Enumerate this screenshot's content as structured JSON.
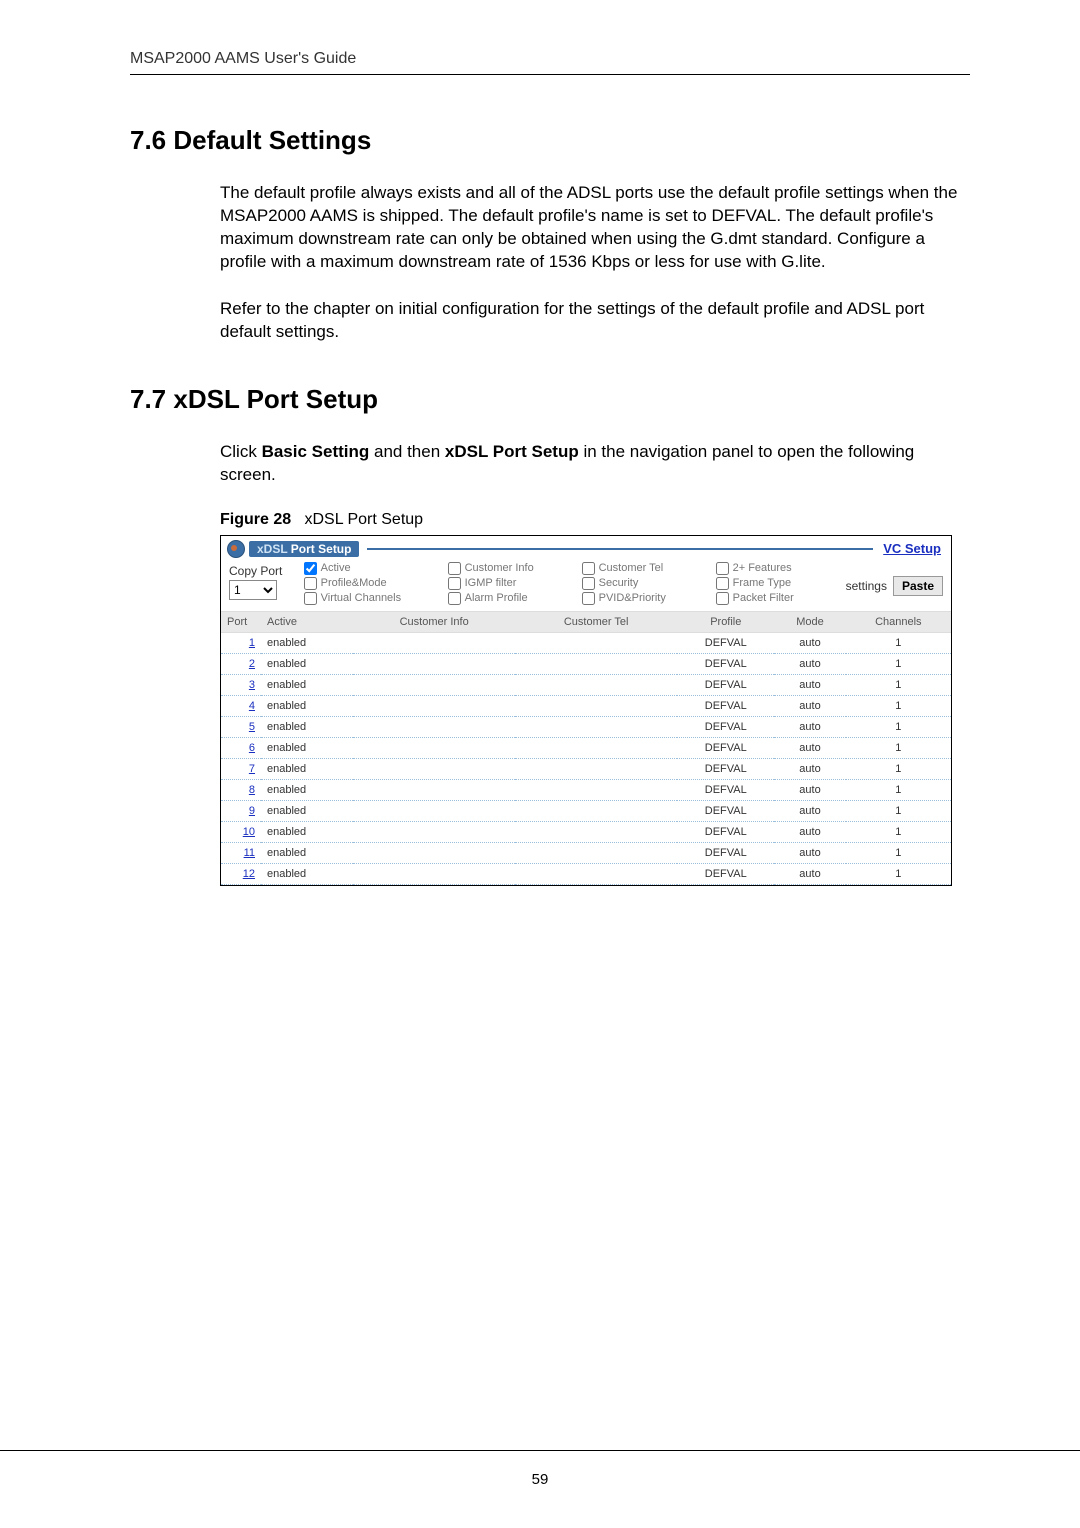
{
  "running_head": "MSAP2000 AAMS User's Guide",
  "sections": {
    "s76": {
      "heading": "7.6   Default Settings",
      "p1": "The default profile always exists and all of the ADSL ports use the default profile settings when the MSAP2000 AAMS is shipped. The default profile's name is set to DEFVAL. The default profile's maximum downstream rate can only be obtained when using the G.dmt standard. Configure a profile with a maximum downstream rate of 1536 Kbps or less for use with G.lite.",
      "p2": "Refer to the chapter on initial configuration for the settings of the default profile and ADSL port default settings."
    },
    "s77": {
      "heading": "7.7   xDSL Port Setup",
      "p1_pre": "Click ",
      "p1_b1": "Basic Setting",
      "p1_mid": " and then ",
      "p1_b2": "xDSL Port Setup",
      "p1_post": " in the navigation panel to open the following screen."
    }
  },
  "figure": {
    "label": "Figure 28",
    "caption": "xDSL Port Setup"
  },
  "screenshot": {
    "title_prefix": "xDSL",
    "title_main": " Port Setup",
    "vc_link": "VC Setup",
    "copy_label": "Copy   Port",
    "copy_options": [
      "1"
    ],
    "copy_selected": "1",
    "settings_label": "settings",
    "paste_button": "Paste",
    "checkboxes": [
      {
        "label": "Active",
        "checked": true
      },
      {
        "label": "Customer Info",
        "checked": false
      },
      {
        "label": "Customer Tel",
        "checked": false
      },
      {
        "label": "2+ Features",
        "checked": false
      },
      {
        "label": "Profile&Mode",
        "checked": false
      },
      {
        "label": "IGMP filter",
        "checked": false
      },
      {
        "label": "Security",
        "checked": false
      },
      {
        "label": "Frame Type",
        "checked": false
      },
      {
        "label": "Virtual Channels",
        "checked": false
      },
      {
        "label": "Alarm Profile",
        "checked": false
      },
      {
        "label": "PVID&Priority",
        "checked": false
      },
      {
        "label": "Packet Filter",
        "checked": false
      }
    ],
    "columns": {
      "port": "Port",
      "active": "Active",
      "custinfo": "Customer Info",
      "custtel": "Customer Tel",
      "profile": "Profile",
      "mode": "Mode",
      "channels": "Channels"
    },
    "rows": [
      {
        "port": "1",
        "active": "enabled",
        "custinfo": "",
        "custtel": "",
        "profile": "DEFVAL",
        "mode": "auto",
        "channels": "1"
      },
      {
        "port": "2",
        "active": "enabled",
        "custinfo": "",
        "custtel": "",
        "profile": "DEFVAL",
        "mode": "auto",
        "channels": "1"
      },
      {
        "port": "3",
        "active": "enabled",
        "custinfo": "",
        "custtel": "",
        "profile": "DEFVAL",
        "mode": "auto",
        "channels": "1"
      },
      {
        "port": "4",
        "active": "enabled",
        "custinfo": "",
        "custtel": "",
        "profile": "DEFVAL",
        "mode": "auto",
        "channels": "1"
      },
      {
        "port": "5",
        "active": "enabled",
        "custinfo": "",
        "custtel": "",
        "profile": "DEFVAL",
        "mode": "auto",
        "channels": "1"
      },
      {
        "port": "6",
        "active": "enabled",
        "custinfo": "",
        "custtel": "",
        "profile": "DEFVAL",
        "mode": "auto",
        "channels": "1"
      },
      {
        "port": "7",
        "active": "enabled",
        "custinfo": "",
        "custtel": "",
        "profile": "DEFVAL",
        "mode": "auto",
        "channels": "1"
      },
      {
        "port": "8",
        "active": "enabled",
        "custinfo": "",
        "custtel": "",
        "profile": "DEFVAL",
        "mode": "auto",
        "channels": "1"
      },
      {
        "port": "9",
        "active": "enabled",
        "custinfo": "",
        "custtel": "",
        "profile": "DEFVAL",
        "mode": "auto",
        "channels": "1"
      },
      {
        "port": "10",
        "active": "enabled",
        "custinfo": "",
        "custtel": "",
        "profile": "DEFVAL",
        "mode": "auto",
        "channels": "1"
      },
      {
        "port": "11",
        "active": "enabled",
        "custinfo": "",
        "custtel": "",
        "profile": "DEFVAL",
        "mode": "auto",
        "channels": "1"
      },
      {
        "port": "12",
        "active": "enabled",
        "custinfo": "",
        "custtel": "",
        "profile": "DEFVAL",
        "mode": "auto",
        "channels": "1"
      }
    ]
  },
  "page_number": "59"
}
